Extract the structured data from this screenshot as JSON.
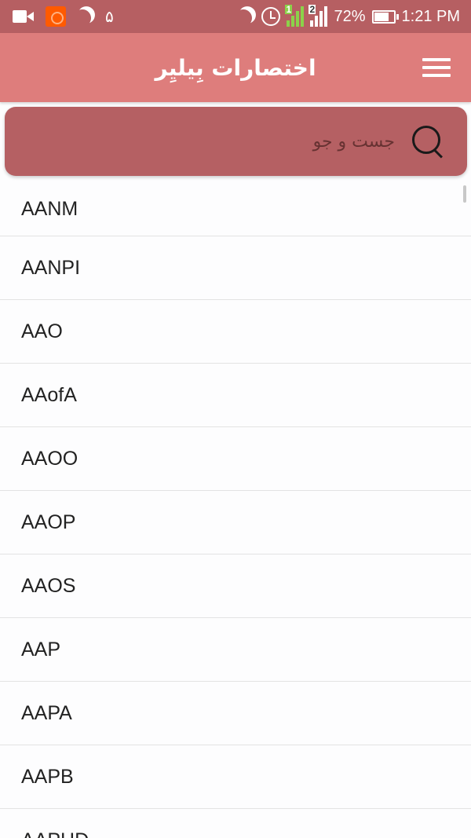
{
  "status_bar": {
    "left_text": "۵",
    "battery": "72%",
    "time": "1:21 PM",
    "sim1_badge": "1",
    "sim2_badge": "2"
  },
  "app_bar": {
    "title": "اختصارات بِیلیِر"
  },
  "search": {
    "placeholder": "جست و جو"
  },
  "list": {
    "items": [
      "AANM",
      "AANPI",
      "AAO",
      "AAofA",
      "AAOO",
      "AAOP",
      "AAOS",
      "AAP",
      "AAPA",
      "AAPB",
      "AAPHD"
    ]
  }
}
